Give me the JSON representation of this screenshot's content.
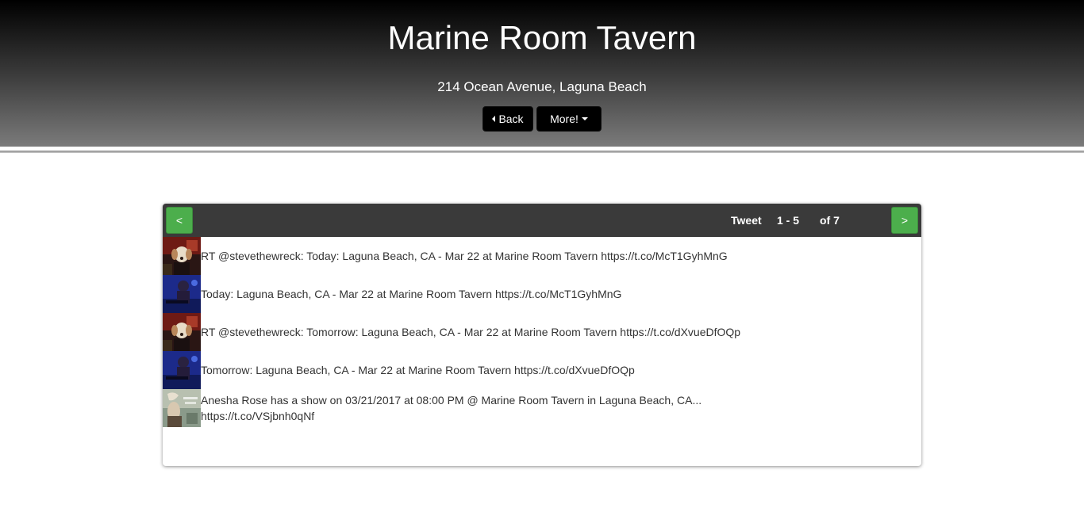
{
  "header": {
    "title": "Marine Room Tavern",
    "address": "214 Ocean Avenue, Laguna Beach",
    "back_label": "Back",
    "more_label": "More!"
  },
  "pager": {
    "prev_label": "<",
    "next_label": ">",
    "label": "Tweet",
    "range": "1 - 5",
    "of": "of 7"
  },
  "tweets": [
    {
      "avatar": "dog-avatar-icon",
      "text": "RT @stevethewreck: Today: Laguna Beach, CA - Mar 22 at Marine Room Tavern https://t.co/McT1GyhMnG"
    },
    {
      "avatar": "musician-avatar-icon",
      "text": "Today: Laguna Beach, CA - Mar 22 at Marine Room Tavern https://t.co/McT1GyhMnG"
    },
    {
      "avatar": "dog-avatar-icon",
      "text": "RT @stevethewreck: Tomorrow: Laguna Beach, CA - Mar 22 at Marine Room Tavern https://t.co/dXvueDfOQp"
    },
    {
      "avatar": "musician-avatar-icon",
      "text": "Tomorrow: Laguna Beach, CA - Mar 22 at Marine Room Tavern https://t.co/dXvueDfOQp"
    },
    {
      "avatar": "singer-avatar-icon",
      "text": "Anesha Rose has a show on 03/21/2017 at 08:00 PM @ Marine Room Tavern in Laguna Beach, CA... https://t.co/VSjbnh0qNf"
    }
  ],
  "colors": {
    "header_top": "#000000",
    "header_bottom": "#7b7b7b",
    "panel_head": "#3a3a3a",
    "nav_button": "#4cae4c",
    "tweet_text": "#333333"
  }
}
